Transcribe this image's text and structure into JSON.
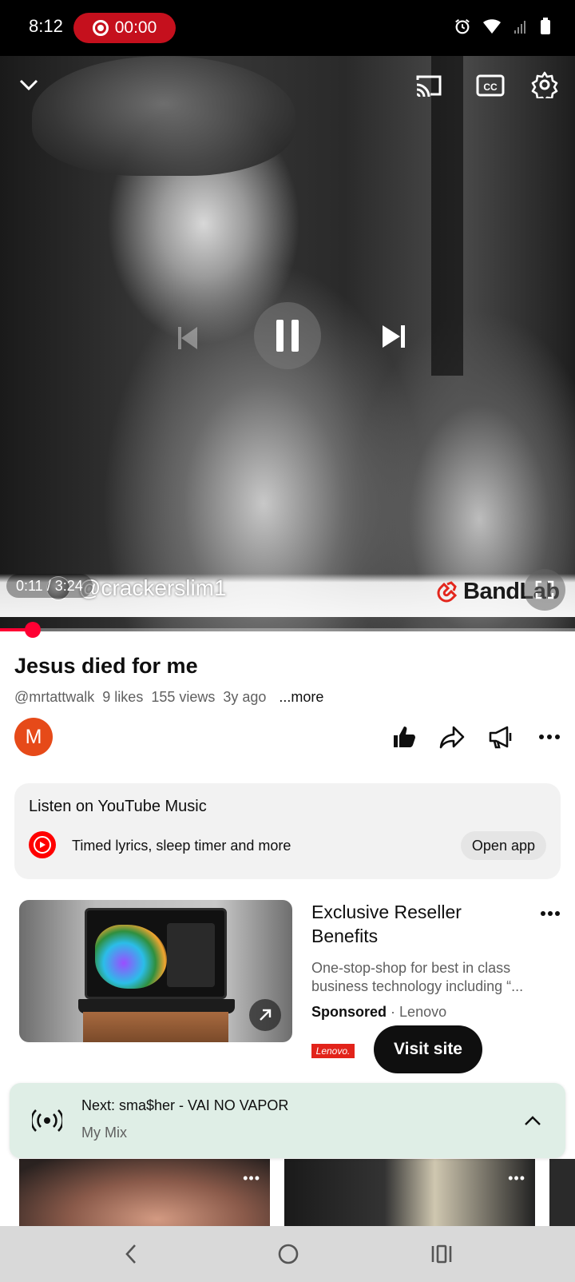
{
  "status_bar": {
    "time": "8:12",
    "recording_time": "00:00",
    "icons": [
      "alarm-icon",
      "wifi-icon",
      "signal-icon",
      "battery-icon"
    ]
  },
  "player": {
    "current_time": "0:11",
    "duration": "3:24",
    "time_display": "0:11 / 3:24",
    "progress_fraction": 0.057,
    "watermark_handle": "@crackerslim1",
    "watermark_brand": "BandLab",
    "controls": [
      "collapse-icon",
      "cast-icon",
      "captions-icon",
      "settings-icon",
      "previous-icon",
      "pause-icon",
      "next-icon",
      "fullscreen-icon"
    ]
  },
  "video_info": {
    "title": "Jesus died for me",
    "channel_handle": "@mrtattwalk",
    "likes": "9 likes",
    "views": "155 views",
    "age": "3y ago",
    "more_label": "...more",
    "channel_avatar_letter": "M"
  },
  "music_card": {
    "title": "Listen on YouTube Music",
    "description": "Timed lyrics, sleep timer and more",
    "button_label": "Open app"
  },
  "ad": {
    "title": "Exclusive Reseller Benefits",
    "description": "One-stop-shop for best in class business technology including “...",
    "sponsored_label": "Sponsored",
    "separator": "·",
    "advertiser": "Lenovo",
    "badge_text": "Lenovo.",
    "cta_label": "Visit site"
  },
  "up_next": {
    "title": "Next: sma$her - VAI NO VAPOR",
    "subtitle": "My Mix"
  },
  "colors": {
    "accent_red": "#ff0033",
    "recording_red": "#c5101d",
    "bandlab_red": "#e3261c",
    "next_bar_bg": "#dfeee6"
  }
}
